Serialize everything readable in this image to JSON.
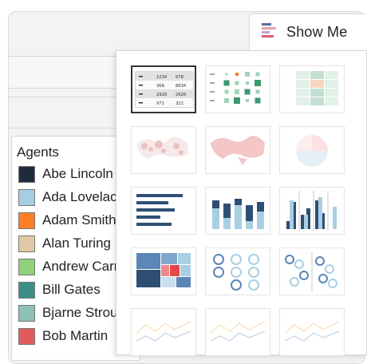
{
  "show_me": {
    "label": "Show Me"
  },
  "legend": {
    "title": "Agents",
    "items": [
      {
        "name": "Abe Lincoln",
        "color": "#1f2b3d"
      },
      {
        "name": "Ada Lovelace",
        "color": "#a6cee3"
      },
      {
        "name": "Adam Smith",
        "color": "#ff7f27"
      },
      {
        "name": "Alan Turing",
        "color": "#e0c9a6"
      },
      {
        "name": "Andrew Carnegie",
        "color": "#8fd27a"
      },
      {
        "name": "Bill Gates",
        "color": "#3d8f86"
      },
      {
        "name": "Bjarne Stroustrup",
        "color": "#8dc1b6"
      },
      {
        "name": "Bob Martin",
        "color": "#e05c5c"
      }
    ]
  },
  "chart_types": [
    {
      "kind": "text-table",
      "state": "selected"
    },
    {
      "kind": "heat-map",
      "state": "available"
    },
    {
      "kind": "highlight-table",
      "state": "unavailable"
    },
    {
      "kind": "symbol-map",
      "state": "unavailable"
    },
    {
      "kind": "filled-map",
      "state": "unavailable"
    },
    {
      "kind": "pie-chart",
      "state": "unavailable"
    },
    {
      "kind": "horizontal-bars",
      "state": "available"
    },
    {
      "kind": "stacked-bars",
      "state": "available"
    },
    {
      "kind": "side-by-side-bars",
      "state": "available"
    },
    {
      "kind": "treemap",
      "state": "available"
    },
    {
      "kind": "circle-view",
      "state": "available"
    },
    {
      "kind": "side-by-side-circles",
      "state": "available"
    },
    {
      "kind": "lines-continuous",
      "state": "unavailable"
    },
    {
      "kind": "lines-discrete",
      "state": "unavailable"
    },
    {
      "kind": "dual-lines",
      "state": "unavailable"
    }
  ],
  "text_table_values": [
    "1234",
    "678",
    "368",
    "8034",
    "2920",
    "2920",
    "971",
    "322"
  ]
}
